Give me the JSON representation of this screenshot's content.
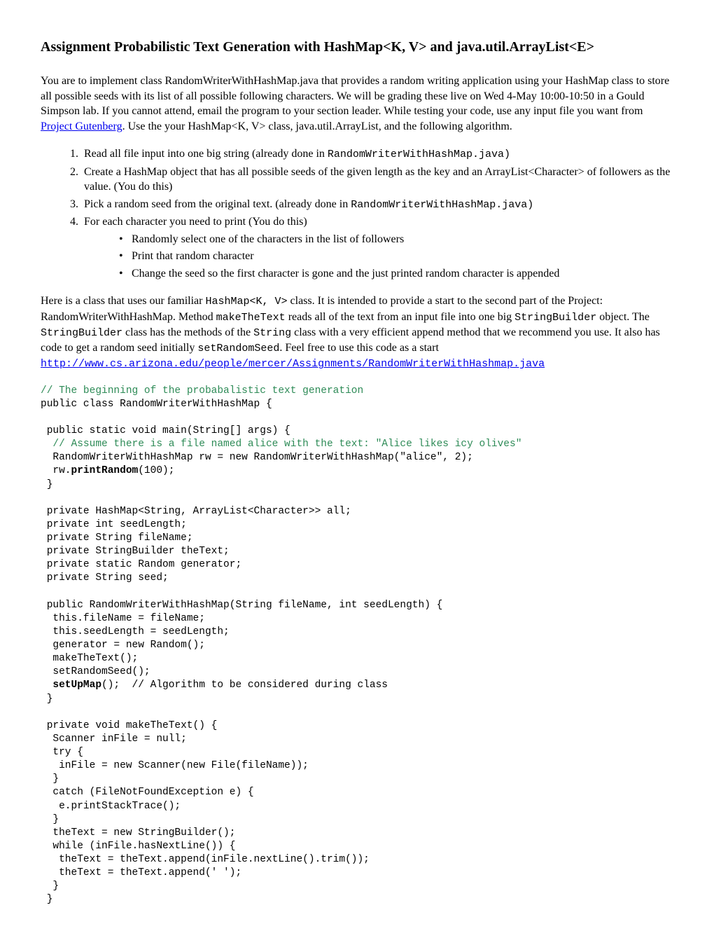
{
  "title": "Assignment Probabilistic Text Generation with HashMap<K, V> and java.util.ArrayList<E>",
  "intro": {
    "p1a": "You are to implement class RandomWriterWithHashMap.java that provides a random writing application using your HashMap class to store all possible seeds with its list of all possible following characters.  We will be grading these live on Wed 4-May 10:00-10:50 in a Gould Simpson lab.  If you cannot attend, email the program to your section leader. While testing your code, use any input file you want from ",
    "link_text": "Project Gutenberg",
    "p1b": ". Use the your HashMap<K, V> class, java.util.ArrayList, and the following algorithm."
  },
  "steps": {
    "s1a": "Read all file input into one big string (already done in ",
    "s1b": "RandomWriterWithHashMap.java)",
    "s2": "Create a HashMap object that has all possible seeds of the given length as the key and an ArrayList<Character> of followers as the value.  (You do this)",
    "s3a": "Pick a random seed from the original text.  (already done in ",
    "s3b": "RandomWriterWithHashMap.java)",
    "s4": "For each character you need to print  (You do this)",
    "b1": "Randomly select one of the characters in the list of followers",
    "b2": "Print that random character",
    "b3": "Change the seed so the first character is gone and the just printed random character is appended"
  },
  "desc": {
    "t1": "Here is a class that uses our familiar ",
    "m1": "HashMap<K, V>",
    "t2": " class. It is intended to provide a start to the second part of the Project: RandomWriterWithHashMap. Method ",
    "m2": "makeTheText",
    "t3": " reads all of the text from an input file into one big ",
    "m3": "StringBuilder",
    "t4": " object. The ",
    "m4": "StringBuilder",
    "t5": " class has the methods of the ",
    "m5": "String",
    "t6": " class with a very efficient append method that we recommend you use. It also has code to get a random seed initially ",
    "m6": "setRandomSeed",
    "t7": ". Feel free to use this code as a start ",
    "link": "http://www.cs.arizona.edu/people/mercer/Assignments/RandomWriterWithHashmap.java"
  },
  "code": {
    "c01": "// The beginning of the probabalistic text generation",
    "c02": "public class RandomWriterWithHashMap {",
    "c03": "",
    "c04": " public static void main(String[] args) {",
    "c05": "  // Assume there is a file named alice with the text: \"Alice likes icy olives\"",
    "c06": "  RandomWriterWithHashMap rw = new RandomWriterWithHashMap(\"alice\", 2);",
    "c07a": "  rw.",
    "c07b": "printRandom",
    "c07c": "(100);",
    "c08": " }",
    "c09": "",
    "c10": " private HashMap<String, ArrayList<Character>> all;",
    "c11": " private int seedLength;",
    "c12": " private String fileName;",
    "c13": " private StringBuilder theText;",
    "c14": " private static Random generator;",
    "c15": " private String seed;",
    "c16": "",
    "c17": " public RandomWriterWithHashMap(String fileName, int seedLength) {",
    "c18": "  this.fileName = fileName;",
    "c19": "  this.seedLength = seedLength;",
    "c20": "  generator = new Random();",
    "c21": "  makeTheText();",
    "c22": "  setRandomSeed();",
    "c23a": "  ",
    "c23b": "setUpMap",
    "c23c": "();  // Algorithm to be considered during class",
    "c24": " }",
    "c25": "",
    "c26": " private void makeTheText() {",
    "c27": "  Scanner inFile = null;",
    "c28": "  try {",
    "c29": "   inFile = new Scanner(new File(fileName));",
    "c30": "  }",
    "c31": "  catch (FileNotFoundException e) {",
    "c32": "   e.printStackTrace();",
    "c33": "  }",
    "c34": "  theText = new StringBuilder();",
    "c35": "  while (inFile.hasNextLine()) {",
    "c36": "   theText = theText.append(inFile.nextLine().trim());",
    "c37": "   theText = theText.append(' ');",
    "c38": "  }",
    "c39": " }"
  }
}
